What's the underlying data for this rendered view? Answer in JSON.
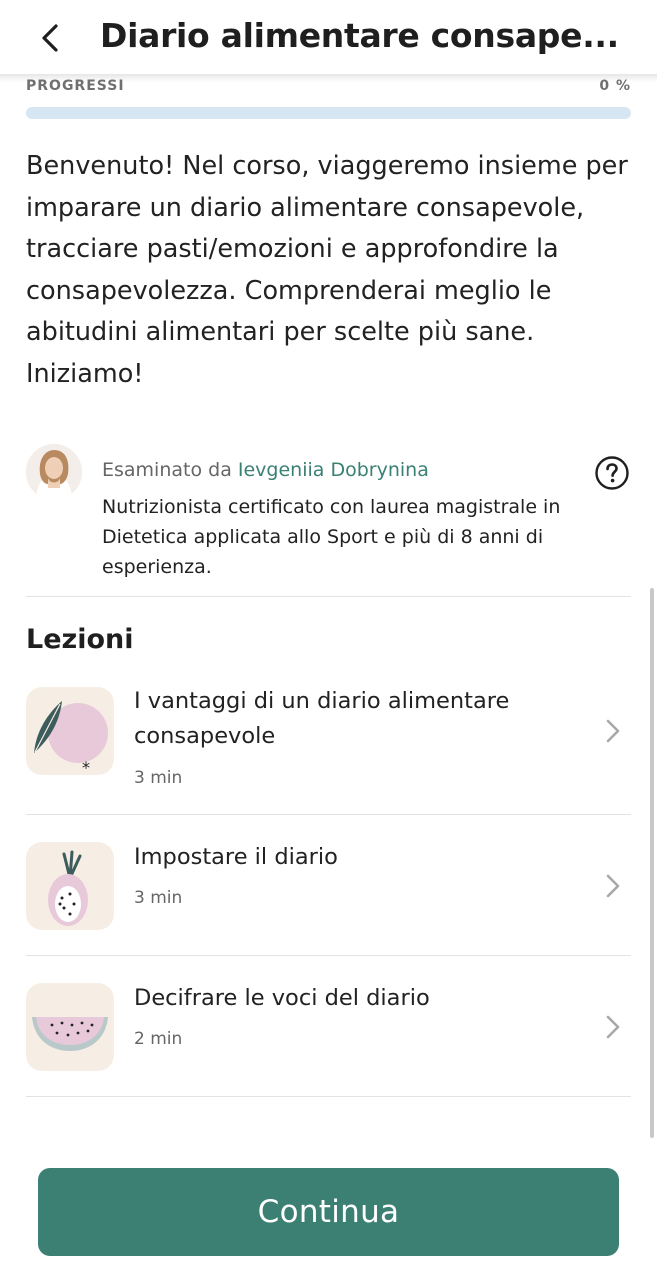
{
  "header": {
    "title": "Diario alimentare consape..."
  },
  "progress": {
    "label": "PROGRESSI",
    "value_text": "0 %",
    "fraction": 0
  },
  "intro_text": "Benvenuto! Nel corso, viaggeremo insieme per imparare un diario alimentare consapevole, tracciare pasti/emozioni e approfondire la consapevolezza. Comprenderai meglio le abitudini alimentari per scelte più sane. Iniziamo!",
  "reviewer": {
    "prefix": "Esaminato da",
    "name": "Ievgeniia Dobrynina",
    "bio": "Nutrizionista certificato con laurea magistrale in Dietetica applicata allo Sport e più di 8 anni di esperienza."
  },
  "lessons_section": {
    "title": "Lezioni",
    "items": [
      {
        "title": "I vantaggi di un diario alimentare consapevole",
        "duration": "3 min",
        "icon": "plum-icon"
      },
      {
        "title": "Impostare il diario",
        "duration": "3 min",
        "icon": "dragon-fruit-icon"
      },
      {
        "title": "Decifrare le voci del diario",
        "duration": "2 min",
        "icon": "watermelon-icon"
      }
    ]
  },
  "footer": {
    "continue_label": "Continua"
  },
  "colors": {
    "accent": "#3b8073",
    "progress_track": "#d6e6f3",
    "lesson_icon_bg": "#f6eee4"
  }
}
